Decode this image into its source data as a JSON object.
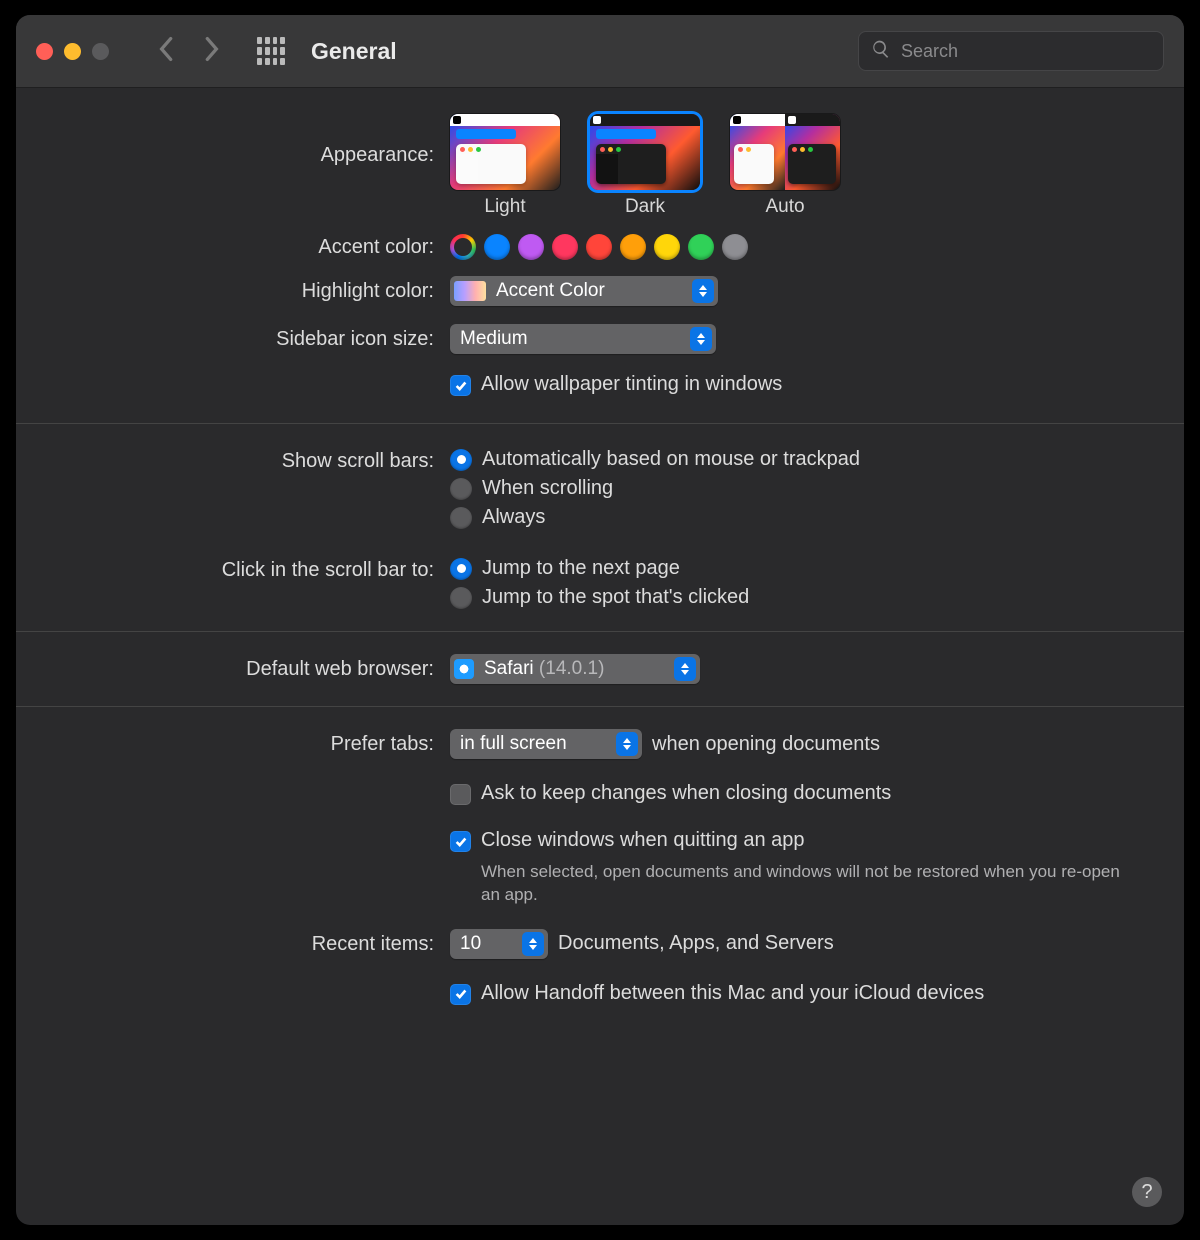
{
  "window": {
    "title": "General"
  },
  "toolbar": {
    "search_placeholder": "Search"
  },
  "appearance": {
    "label": "Appearance:",
    "options": {
      "light": "Light",
      "dark": "Dark",
      "auto": "Auto"
    },
    "selected": "dark"
  },
  "accent": {
    "label": "Accent color:",
    "colors": [
      "multicolor",
      "blue",
      "purple",
      "pink",
      "red",
      "orange",
      "yellow",
      "green",
      "graphite"
    ]
  },
  "highlight": {
    "label": "Highlight color:",
    "value": "Accent Color"
  },
  "sidebar_icon": {
    "label": "Sidebar icon size:",
    "value": "Medium"
  },
  "wallpaper_tint": {
    "label": "Allow wallpaper tinting in windows",
    "checked": true
  },
  "scrollbars": {
    "label": "Show scroll bars:",
    "options": {
      "auto": "Automatically based on mouse or trackpad",
      "scrolling": "When scrolling",
      "always": "Always"
    },
    "selected": "auto"
  },
  "scrollclick": {
    "label": "Click in the scroll bar to:",
    "options": {
      "page": "Jump to the next page",
      "spot": "Jump to the spot that's clicked"
    },
    "selected": "page"
  },
  "browser": {
    "label": "Default web browser:",
    "name": "Safari",
    "version": "(14.0.1)"
  },
  "prefertabs": {
    "label": "Prefer tabs:",
    "value": "in full screen",
    "suffix": "when opening documents"
  },
  "ask_keep": {
    "label": "Ask to keep changes when closing documents",
    "checked": false
  },
  "close_windows": {
    "label": "Close windows when quitting an app",
    "sub": "When selected, open documents and windows will not be restored when you re-open an app.",
    "checked": true
  },
  "recent": {
    "label": "Recent items:",
    "value": "10",
    "suffix": "Documents, Apps, and Servers"
  },
  "handoff": {
    "label": "Allow Handoff between this Mac and your iCloud devices",
    "checked": true
  },
  "help": "?"
}
